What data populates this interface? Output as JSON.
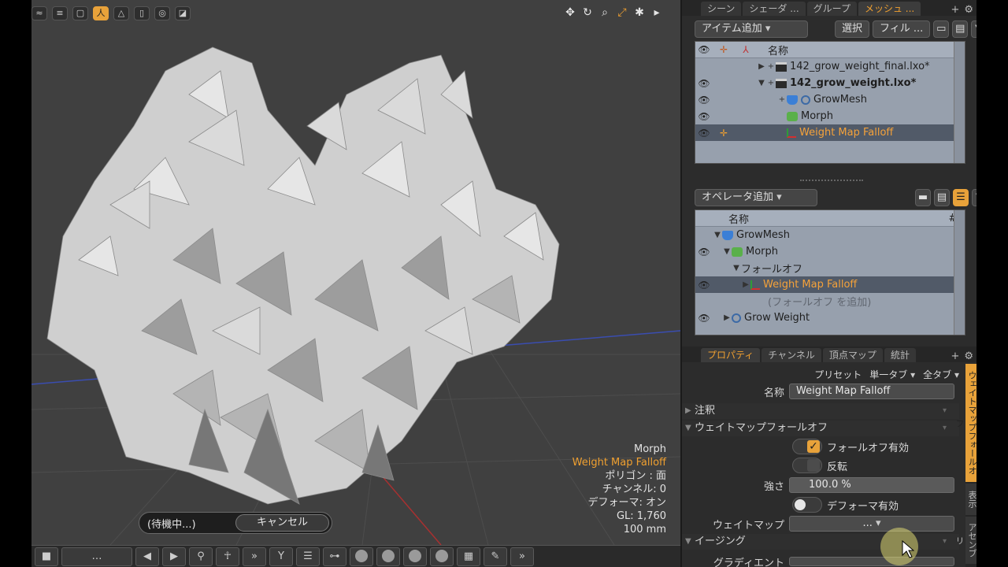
{
  "viewport": {
    "toolbar_icons": [
      "wave-icon",
      "stripes-icon",
      "frame-icon",
      "person-icon",
      "tower-icon",
      "cylinder-icon",
      "stop-icon",
      "shutter-icon"
    ],
    "right_tool_icons": [
      "move-icon",
      "rotate-icon",
      "zoom-icon",
      "fit-icon",
      "gear-icon",
      "play-icon"
    ],
    "hud": {
      "line1": "Morph",
      "line2": "Weight Map Falloff",
      "line3": "ポリゴン : 面",
      "line4": "チャンネル: 0",
      "line5": "デフォーマ: オン",
      "line6": "GL: 1,760",
      "line7": "100 mm"
    },
    "status": {
      "waiting": "(待機中...)",
      "cancel": "キャンセル"
    },
    "bottom_more": "»"
  },
  "scene_panel": {
    "tabs": [
      "シーン",
      "シェーダ ...",
      "グループ",
      "メッシュ ..."
    ],
    "active_tab": 3,
    "add_item": "アイテム追加",
    "select": "選択",
    "filter": "フィル ...",
    "header_name": "名称",
    "items": [
      {
        "label": "142_grow_weight_final.lxo*",
        "bold": false
      },
      {
        "label": "142_grow_weight.lxo*",
        "bold": true
      },
      {
        "label": "GrowMesh"
      },
      {
        "label": "Morph"
      },
      {
        "label": "Weight Map Falloff"
      }
    ]
  },
  "deformer_panel": {
    "add_operator": "オペレータ追加",
    "header_name": "名称",
    "header_hash": "#",
    "items": [
      {
        "label": "GrowMesh"
      },
      {
        "label": "Morph"
      },
      {
        "label": "フォールオフ"
      },
      {
        "label": "Weight Map Falloff"
      },
      {
        "label": "(フォールオフ を追加)"
      },
      {
        "label": "Grow Weight"
      }
    ]
  },
  "properties": {
    "tabs": [
      "プロパティ",
      "チャンネル",
      "頂点マップ",
      "統計"
    ],
    "active_tab": 0,
    "preset": "プリセット",
    "single_tab": "単一タブ",
    "all_tabs": "全タブ",
    "name_label": "名称",
    "name_value": "Weight Map Falloff",
    "sec_annotation": "注釈",
    "sec_weight_falloff": "ウェイトマップフォールオフ",
    "enable_falloff": "フォールオフ有効",
    "invert": "反転",
    "strength_label": "強さ",
    "strength_value": "100.0 %",
    "enable_deformer": "デフォーマ有効",
    "weight_map_label": "ウェイトマップ",
    "weight_map_value": "...",
    "sec_easing": "イージング",
    "gradient_label": "グラディエント",
    "side_tabs": [
      "ウェイトマップフォールオフ",
      "表示",
      "アセンブリ"
    ]
  },
  "colors": {
    "accent": "#e8a23a",
    "viewport_bg": "#404040",
    "list_bg": "#97a0ad",
    "selected_row": "#515a68"
  }
}
